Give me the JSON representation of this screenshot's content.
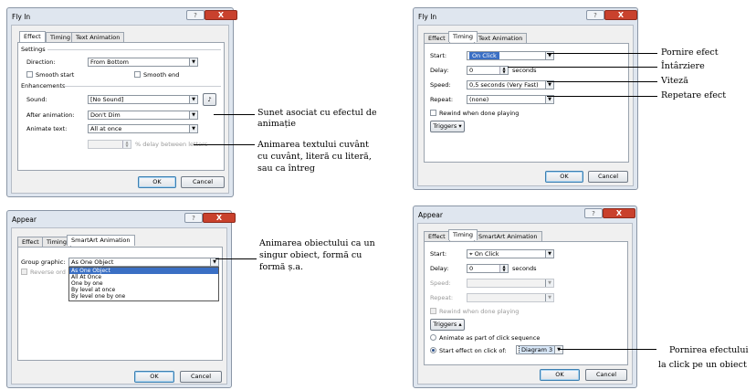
{
  "d1": {
    "title": "Fly In",
    "help": "?",
    "close": "X",
    "tabs": [
      "Effect",
      "Timing",
      "Text Animation"
    ],
    "settings": "Settings",
    "direction_label": "Direction:",
    "direction_value": "From Bottom",
    "smooth_start": "Smooth start",
    "smooth_end": "Smooth end",
    "enhancements": "Enhancements",
    "sound_label": "Sound:",
    "sound_value": "[No Sound]",
    "after_label": "After animation:",
    "after_value": "Don't Dim",
    "animate_label": "Animate text:",
    "animate_value": "All at once",
    "delay_suffix": "% delay between letters",
    "ok": "OK",
    "cancel": "Cancel"
  },
  "d2": {
    "title": "Fly In",
    "help": "?",
    "close": "X",
    "tabs": [
      "Effect",
      "Timing",
      "Text Animation"
    ],
    "start_label": "Start:",
    "start_value": "On Click",
    "delay_label": "Delay:",
    "delay_value": "0",
    "delay_unit": "seconds",
    "speed_label": "Speed:",
    "speed_value": "0,5 seconds (Very Fast)",
    "repeat_label": "Repeat:",
    "repeat_value": "(none)",
    "rewind": "Rewind when done playing",
    "triggers": "Triggers",
    "ok": "OK",
    "cancel": "Cancel"
  },
  "d3": {
    "title": "Appear",
    "help": "?",
    "close": "X",
    "tabs": [
      "Effect",
      "Timing",
      "SmartArt Animation"
    ],
    "group_label": "Group graphic:",
    "group_value": "As One Object",
    "reverse": "Reverse ord",
    "options": [
      "As One Object",
      "All At Once",
      "One by one",
      "By level at once",
      "By level one by one"
    ],
    "ok": "OK",
    "cancel": "Cancel"
  },
  "d4": {
    "title": "Appear",
    "help": "?",
    "close": "X",
    "tabs": [
      "Effect",
      "Timing",
      "SmartArt Animation"
    ],
    "start_label": "Start:",
    "start_value": "On Click",
    "delay_label": "Delay:",
    "delay_value": "0",
    "delay_unit": "seconds",
    "speed_label": "Speed:",
    "repeat_label": "Repeat:",
    "rewind": "Rewind when done playing",
    "triggers": "Triggers",
    "animate_seq": "Animate as part of click sequence",
    "start_on_click": "Start effect on click of:",
    "diagram": "Diagram 3",
    "ok": "OK",
    "cancel": "Cancel"
  },
  "annotations": {
    "a1": "Sunet asociat cu efectul de",
    "a1b": "animație",
    "a2": "Animarea textului cuvânt",
    "a2b": "cu cuvânt, literă cu literă,",
    "a2c": "sau ca întreg",
    "a3": "Animarea obiectului ca un",
    "a3b": "singur obiect, formă cu",
    "a3c": "formă ș.a.",
    "a4": "Pornire efect",
    "a5": "Întârziere",
    "a6": "Viteză",
    "a7": "Repetare efect",
    "a8": "Pornirea efectului",
    "a8b": "la click pe un obiect"
  }
}
